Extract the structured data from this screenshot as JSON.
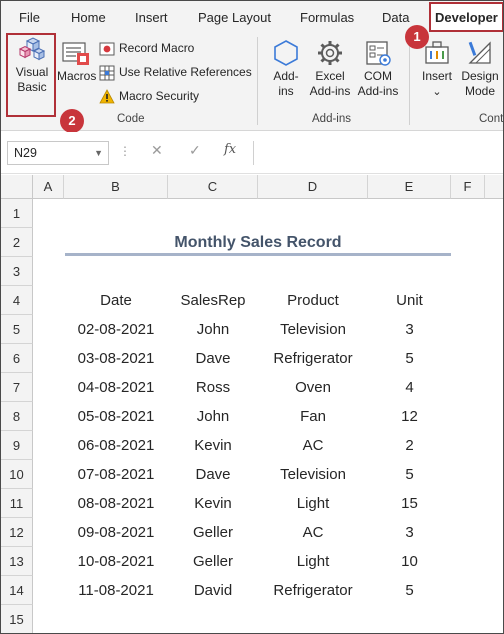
{
  "ribbon_tabs": [
    "File",
    "Home",
    "Insert",
    "Page Layout",
    "Formulas",
    "Data",
    "Developer"
  ],
  "code_group": {
    "visual_basic": [
      "Visual",
      "Basic"
    ],
    "macros": "Macros",
    "record_macro": "Record Macro",
    "use_relative": "Use Relative References",
    "macro_security": "Macro Security",
    "label": "Code"
  },
  "addins_group": {
    "addins": [
      "Add-",
      "ins"
    ],
    "excel_addins": [
      "Excel",
      "Add-ins"
    ],
    "com_addins": [
      "COM",
      "Add-ins"
    ],
    "label": "Add-ins"
  },
  "controls_group": {
    "insert": "Insert",
    "insert_arrow": "⌄",
    "design_mode": [
      "Design",
      "Mode"
    ],
    "label": "Cont"
  },
  "badges": [
    "1",
    "2"
  ],
  "formula_bar": {
    "name_box": "N29",
    "cancel": "✕",
    "enter": "✓",
    "fx": "fx",
    "value": ""
  },
  "columns": [
    "A",
    "B",
    "C",
    "D",
    "E",
    "F"
  ],
  "rows": [
    "1",
    "2",
    "3",
    "4",
    "5",
    "6",
    "7",
    "8",
    "9",
    "10",
    "11",
    "12",
    "13",
    "14",
    "15"
  ],
  "sheet": {
    "title": "Monthly Sales Record",
    "headers": [
      "Date",
      "SalesRep",
      "Product",
      "Unit"
    ],
    "records": [
      [
        "02-08-2021",
        "John",
        "Television",
        "3"
      ],
      [
        "03-08-2021",
        "Dave",
        "Refrigerator",
        "5"
      ],
      [
        "04-08-2021",
        "Ross",
        "Oven",
        "4"
      ],
      [
        "05-08-2021",
        "John",
        "Fan",
        "12"
      ],
      [
        "06-08-2021",
        "Kevin",
        "AC",
        "2"
      ],
      [
        "07-08-2021",
        "Dave",
        "Television",
        "5"
      ],
      [
        "08-08-2021",
        "Kevin",
        "Light",
        "15"
      ],
      [
        "09-08-2021",
        "Geller",
        "AC",
        "3"
      ],
      [
        "10-08-2021",
        "Geller",
        "Light",
        "10"
      ],
      [
        "11-08-2021",
        "David",
        "Refrigerator",
        "5"
      ]
    ]
  },
  "colors": {
    "highlight_red": "#b03038",
    "badge_red": "#c8353b",
    "title_color": "#44546a",
    "title_underline": "#a6b3c9"
  }
}
